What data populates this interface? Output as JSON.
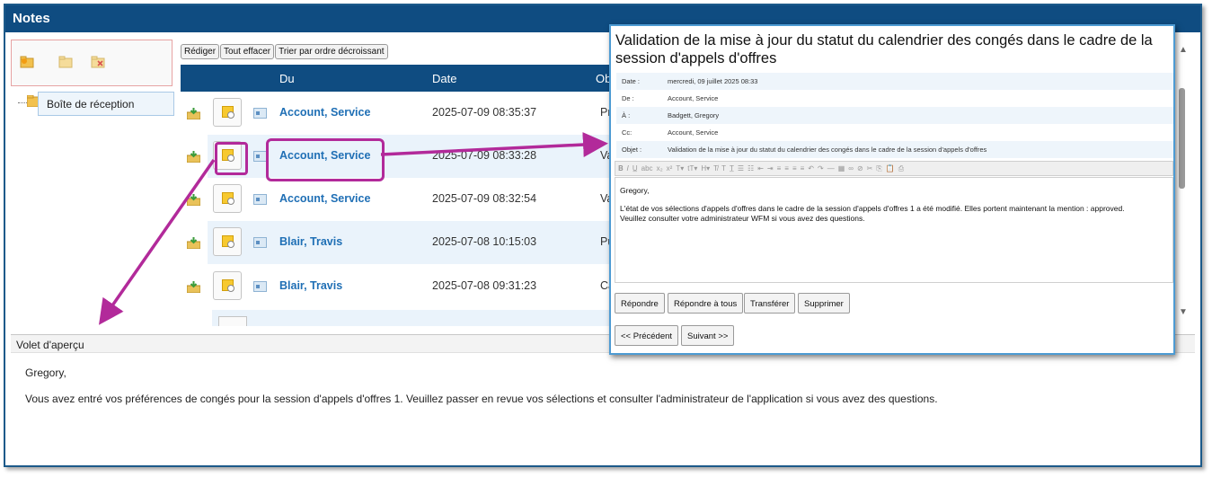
{
  "window": {
    "title": "Notes"
  },
  "folders": {
    "tool_icons": [
      "new-folder-icon",
      "folder-icon",
      "delete-folder-icon"
    ],
    "tree_label": "Boîte de réception"
  },
  "list_toolbar": {
    "compose": "Rédiger",
    "clear_all": "Tout effacer",
    "sort_desc": "Trier par ordre décroissant"
  },
  "list_header": {
    "from": "Du",
    "date": "Date",
    "subject": "Ob"
  },
  "messages": [
    {
      "from": "Account, Service",
      "date": "2025-07-09 08:35:37",
      "subject": "Pré"
    },
    {
      "from": "Account, Service",
      "date": "2025-07-09 08:33:28",
      "subject": "Va"
    },
    {
      "from": "Account, Service",
      "date": "2025-07-09 08:32:54",
      "subject": "Va"
    },
    {
      "from": "Blair, Travis",
      "date": "2025-07-08 10:15:03",
      "subject": "Pu"
    },
    {
      "from": "Blair, Travis",
      "date": "2025-07-08 09:31:23",
      "subject": "Ca"
    }
  ],
  "preview": {
    "label": "Volet d'aperçu",
    "greeting": "Gregory,",
    "body": "Vous avez entré vos préférences de congés pour la session d'appels d'offres 1. Veuillez passer en revue vos sélections et consulter l'administrateur de l'application si vous avez des questions."
  },
  "popup": {
    "title": "Validation de la mise à jour du statut du calendrier des congés dans le cadre de la session d'appels d'offres",
    "meta": [
      {
        "key": "Date :",
        "value": "mercredi, 09 juillet 2025 08:33"
      },
      {
        "key": "De :",
        "value": "Account, Service"
      },
      {
        "key": "À :",
        "value": "Badgett, Gregory"
      },
      {
        "key": "Cc:",
        "value": "Account, Service"
      },
      {
        "key": "Objet :",
        "value": "Validation de la mise à jour du statut du calendrier des congés dans le cadre de la session d'appels d'offres"
      }
    ],
    "body_greeting": "Gregory,",
    "body_line1": "L'état de vos sélections d'appels d'offres dans le cadre de la session d'appels d'offres 1 a été modifié. Elles portent maintenant la mention : approved.",
    "body_line2": "Veuillez consulter votre administrateur WFM si vous avez des questions.",
    "buttons": {
      "reply": "Répondre",
      "reply_all": "Répondre à tous",
      "forward": "Transférer",
      "delete": "Supprimer",
      "previous": "<< Précédent",
      "next": "Suivant >>"
    }
  },
  "colors": {
    "header_blue": "#0f4c81",
    "link_blue": "#1f6fb5",
    "annotation_magenta": "#b22a9a",
    "row_alt": "#eaf3fb"
  }
}
